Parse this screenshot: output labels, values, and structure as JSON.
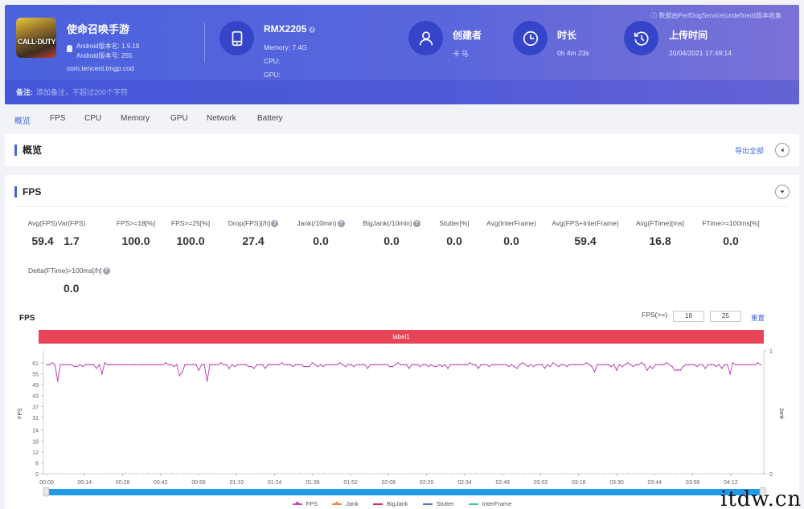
{
  "header": {
    "app": {
      "name": "使命召唤手游",
      "icon_text": "CALL·DUTY",
      "android_version_name": "Android版本名: 1.9.19",
      "android_version_code": "Android版本号: 255",
      "package": "com.tencent.tmgp.cod"
    },
    "device": {
      "model": "RMX2205",
      "memory": "Memory: 7.4G",
      "cpu": "CPU:",
      "gpu": "GPU:"
    },
    "creator": {
      "title": "创建者",
      "value": "卡 马"
    },
    "duration": {
      "title": "时长",
      "value": "0h 4m 23s"
    },
    "upload": {
      "title": "上传时间",
      "value": "20/04/2021 17:49:14"
    },
    "collected_by": "数据由PerfDogService(undefined)版本收集",
    "note_label": "备注:",
    "note_placeholder": "添加备注，不超过200个字符",
    "colors": {
      "header_start": "#4a62dd",
      "header_end": "#7a72d6",
      "icon_circle": "#3445c9"
    }
  },
  "tabs": [
    {
      "label": "概览",
      "active": true
    },
    {
      "label": "FPS",
      "active": false
    },
    {
      "label": "CPU",
      "active": false
    },
    {
      "label": "Memory",
      "active": false
    },
    {
      "label": "GPU",
      "active": false
    },
    {
      "label": "Network",
      "active": false
    },
    {
      "label": "Battery",
      "active": false
    }
  ],
  "overview": {
    "title": "概览",
    "export_label": "导出全部"
  },
  "fps_section": {
    "title": "FPS",
    "metrics": [
      {
        "label": "Avg(FPS)",
        "value": "59.4",
        "help": false
      },
      {
        "label": "Var(FPS)",
        "value": "1.7",
        "help": false
      },
      {
        "label": "FPS>=18[%]",
        "value": "100.0",
        "help": false
      },
      {
        "label": "FPS>=25[%]",
        "value": "100.0",
        "help": false
      },
      {
        "label": "Drop(FPS)[/h]",
        "value": "27.4",
        "help": true
      },
      {
        "label": "Jank(/10min)",
        "value": "0.0",
        "help": true
      },
      {
        "label": "BigJank(/10min)",
        "value": "0.0",
        "help": true
      },
      {
        "label": "Stutter[%]",
        "value": "0.0",
        "help": false
      },
      {
        "label": "Avg(InterFrame)",
        "value": "0.0",
        "help": false
      },
      {
        "label": "Avg(FPS+InterFrame)",
        "value": "59.4",
        "help": false
      },
      {
        "label": "Avg(FTime)[ms]",
        "value": "16.8",
        "help": false
      },
      {
        "label": "FTime>=100ms[%]",
        "value": "0.0",
        "help": false
      },
      {
        "label": "Delta(FTime)>100ms[/h]",
        "value": "0.0",
        "help": true
      }
    ],
    "fps_threshold_label": "FPS(>=)",
    "fps_threshold_1": "18",
    "fps_threshold_2": "25",
    "reset_label": "重置"
  },
  "chart_data": {
    "type": "line",
    "title": "FPS",
    "label_band": "label1",
    "ylabel": "FPS",
    "y2label": "Jank",
    "ylim": [
      0,
      61
    ],
    "y2lim": [
      0,
      1
    ],
    "yticks": [
      0,
      6,
      12,
      18,
      24,
      31,
      37,
      43,
      49,
      55,
      61
    ],
    "y2ticks": [
      0,
      1
    ],
    "xlim_seconds": [
      0,
      263
    ],
    "xticks": [
      "00:00",
      "00:14",
      "00:28",
      "00:42",
      "00:56",
      "01:10",
      "01:24",
      "01:38",
      "01:52",
      "02:06",
      "02:20",
      "02:34",
      "02:48",
      "03:02",
      "03:16",
      "03:30",
      "03:44",
      "03:58",
      "04:12"
    ],
    "legend_position": "bottom-center",
    "legend": [
      {
        "name": "FPS",
        "color": "#c24ab8"
      },
      {
        "name": "Jank",
        "color": "#f0884a"
      },
      {
        "name": "BigJank",
        "color": "#d6304a"
      },
      {
        "name": "Stutter",
        "color": "#5470c6"
      },
      {
        "name": "InterFrame",
        "color": "#3fc5b4"
      }
    ],
    "series": [
      {
        "name": "FPS",
        "color": "#c24ab8",
        "values": [
          60,
          60,
          61,
          60,
          51,
          60,
          60,
          60,
          60,
          60,
          59,
          59,
          60,
          59,
          60,
          60,
          60,
          60,
          58,
          60,
          55,
          61,
          60,
          60,
          60,
          60,
          60,
          60,
          60,
          60,
          60,
          60,
          60,
          60,
          60,
          60,
          60,
          60,
          60,
          60,
          60,
          60,
          60,
          61,
          60,
          60,
          59,
          60,
          54,
          56,
          60,
          60,
          60,
          60,
          60,
          57,
          60,
          60,
          51,
          60,
          60,
          60,
          60,
          61,
          60,
          60,
          58,
          60,
          59,
          60,
          60,
          60,
          60,
          59,
          59,
          58,
          60,
          60,
          60,
          58,
          60,
          60,
          60,
          60,
          60,
          61,
          60,
          60,
          60,
          59,
          60,
          60,
          60,
          59,
          59,
          59,
          61,
          60,
          59,
          60,
          59,
          60,
          60,
          60,
          60,
          60,
          61,
          60,
          59,
          60,
          60,
          59,
          60,
          60,
          60,
          60,
          58,
          60,
          60,
          60,
          60,
          60,
          60,
          60,
          59,
          59,
          60,
          61,
          60,
          60,
          60,
          58,
          60,
          60,
          60,
          59,
          60,
          60,
          59,
          60,
          59,
          59,
          60,
          59,
          60,
          58,
          60,
          60,
          60,
          60,
          60,
          60,
          60,
          61,
          60,
          60,
          58,
          60,
          60,
          60,
          59,
          60,
          60,
          60,
          60,
          60,
          60,
          59,
          60,
          59,
          58,
          60,
          61,
          60,
          59,
          60,
          59,
          60,
          60,
          60,
          58,
          60,
          59,
          61,
          60,
          59,
          60,
          60,
          59,
          60,
          60,
          60,
          60,
          60,
          60,
          61,
          60,
          59,
          56,
          60,
          60,
          60,
          60,
          60,
          59,
          60,
          57,
          60,
          59,
          60,
          61,
          60,
          59,
          60,
          60,
          61,
          60,
          57,
          59,
          58,
          60,
          60,
          60,
          60,
          61,
          60,
          59,
          57,
          57,
          57,
          59,
          60,
          60,
          60,
          60,
          59,
          60,
          60,
          58,
          60,
          60,
          60,
          59,
          60,
          58,
          60,
          60,
          55,
          61,
          60,
          60,
          60,
          60,
          60,
          60,
          60,
          60,
          61,
          60
        ]
      },
      {
        "name": "Jank",
        "color": "#f0884a",
        "values": []
      },
      {
        "name": "BigJank",
        "color": "#d6304a",
        "values": []
      },
      {
        "name": "Stutter",
        "color": "#5470c6",
        "values": []
      },
      {
        "name": "InterFrame",
        "color": "#3fc5b4",
        "values": []
      }
    ],
    "zoom_range_percent": [
      0,
      100
    ]
  }
}
